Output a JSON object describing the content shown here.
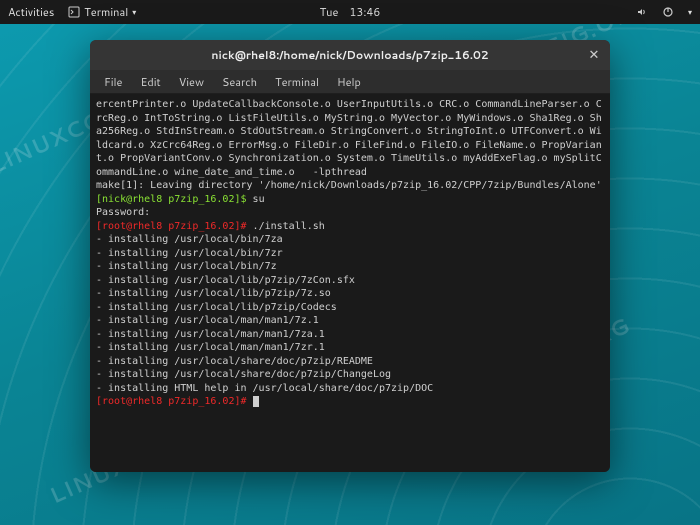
{
  "topbar": {
    "activities": "Activities",
    "app": "Terminal",
    "day": "Tue",
    "time": "13:46"
  },
  "watermark": "LINUXCONFIG.ORG",
  "window": {
    "title": "nick@rhel8:/home/nick/Downloads/p7zip_16.02",
    "menus": [
      "File",
      "Edit",
      "View",
      "Search",
      "Terminal",
      "Help"
    ]
  },
  "term": {
    "wrapped_objs1": "ercentPrinter.o UpdateCallbackConsole.o UserInputUtils.o CRC.o CommandLineParser.o CrcReg.o IntToString.o ListFileUtils.o MyString.o MyVector.o MyWindows.o Sha1Reg.o Sha256Reg.o StdInStream.o StdOutStream.o StringConvert.o StringToInt.o UTFConvert.o Wildcard.o XzCrc64Reg.o ErrorMsg.o FileDir.o FileFind.o FileIO.o FileName.o PropVariant.o PropVariantConv.o Synchronization.o System.o TimeUtils.o myAddExeFlag.o mySplitCommandLine.o wine_date_and_time.o   -lpthread",
    "make_leave": "make[1]: Leaving directory '/home/nick/Downloads/p7zip_16.02/CPP/7zip/Bundles/Alone'",
    "prompt_user": "[nick@rhel8 p7zip_16.02]$ ",
    "cmd_su": "su",
    "password_label": "Password:",
    "prompt_root": "[root@rhel8 p7zip_16.02]# ",
    "cmd_install": "./install.sh",
    "install_lines": [
      "- installing /usr/local/bin/7za",
      "- installing /usr/local/bin/7zr",
      "- installing /usr/local/bin/7z",
      "- installing /usr/local/lib/p7zip/7zCon.sfx",
      "- installing /usr/local/lib/p7zip/7z.so",
      "- installing /usr/local/lib/p7zip/Codecs",
      "- installing /usr/local/man/man1/7z.1",
      "- installing /usr/local/man/man1/7za.1",
      "- installing /usr/local/man/man1/7zr.1",
      "- installing /usr/local/share/doc/p7zip/README",
      "- installing /usr/local/share/doc/p7zip/ChangeLog",
      "- installing HTML help in /usr/local/share/doc/p7zip/DOC"
    ]
  }
}
